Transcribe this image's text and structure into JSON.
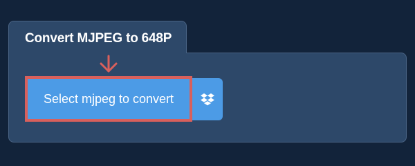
{
  "converter": {
    "title": "Convert MJPEG to 648P",
    "select_label": "Select mjpeg to convert"
  },
  "icons": {
    "arrow": "arrow-down-icon",
    "dropbox": "dropbox-icon"
  },
  "colors": {
    "background": "#12233a",
    "panel": "#2d4869",
    "button": "#4c9be6",
    "highlight": "#d9605c",
    "text": "#ffffff"
  }
}
